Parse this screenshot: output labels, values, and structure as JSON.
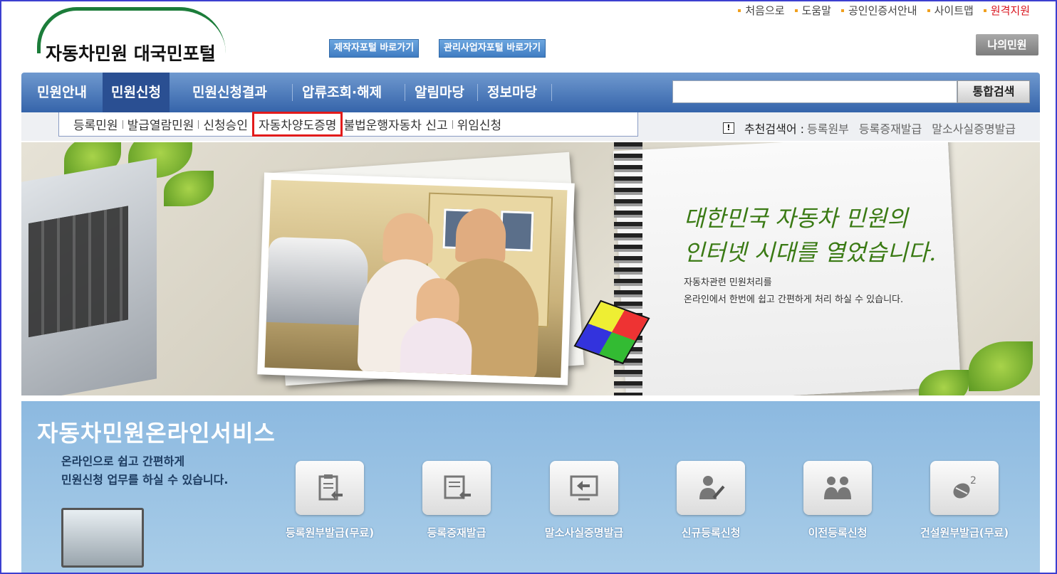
{
  "util_links": [
    {
      "label": "처음으로"
    },
    {
      "label": "도움말"
    },
    {
      "label": "공인인증서안내"
    },
    {
      "label": "사이트맵"
    },
    {
      "label": "원격지원"
    }
  ],
  "logo": {
    "text": "자동차민원 대국민포털"
  },
  "portal_buttons": {
    "maker": "제작자포털 바로가기",
    "admin": "관리사업자포털 바로가기"
  },
  "my_button": "나의민원",
  "nav": {
    "items": [
      {
        "label": "민원안내"
      },
      {
        "label": "민원신청"
      },
      {
        "label": "민원신청결과"
      },
      {
        "label": "압류조회·해제"
      },
      {
        "label": "알림마당"
      },
      {
        "label": "정보마당"
      }
    ],
    "search_value": "",
    "search_button": "통합검색"
  },
  "submenu": [
    "등록민원",
    "발급열람민원",
    "신청승인",
    "자동차양도증명",
    "불법운행자동차 신고",
    "위임신청"
  ],
  "recommend": {
    "label": "추천검색어 :",
    "terms": [
      "등록원부",
      "등록증재발급",
      "말소사실증명발급"
    ]
  },
  "banner": {
    "slogan_line1": "대한민국 자동차 민원의",
    "slogan_line2": "인터넷 시대를 열었습니다.",
    "sub_line1": "자동차관련 민원처리를",
    "sub_line2": "온라인에서 한번에 쉽고 간편하게 처리 하실 수 있습니다."
  },
  "service": {
    "title": "자동차민원온라인서비스",
    "desc_line1": "온라인으로 쉽고 간편하게",
    "desc_line2": "민원신청 업무를 하실 수 있습니다.",
    "items": [
      {
        "label": "등록원부발급(무료)",
        "icon": "clipboard-arrow-icon"
      },
      {
        "label": "등록증재발급",
        "icon": "document-arrow-icon"
      },
      {
        "label": "말소사실증명발급",
        "icon": "monitor-arrow-icon"
      },
      {
        "label": "신규등록신청",
        "icon": "person-pen-icon"
      },
      {
        "label": "이전등록신청",
        "icon": "two-persons-icon"
      },
      {
        "label": "건설원부발급(무료)",
        "icon": "mouse-icon"
      }
    ]
  },
  "colors": {
    "nav": "#3564aa",
    "highlight": "#e21b1b",
    "accent_green": "#1c7d3a",
    "frame": "#3c3fd0"
  }
}
